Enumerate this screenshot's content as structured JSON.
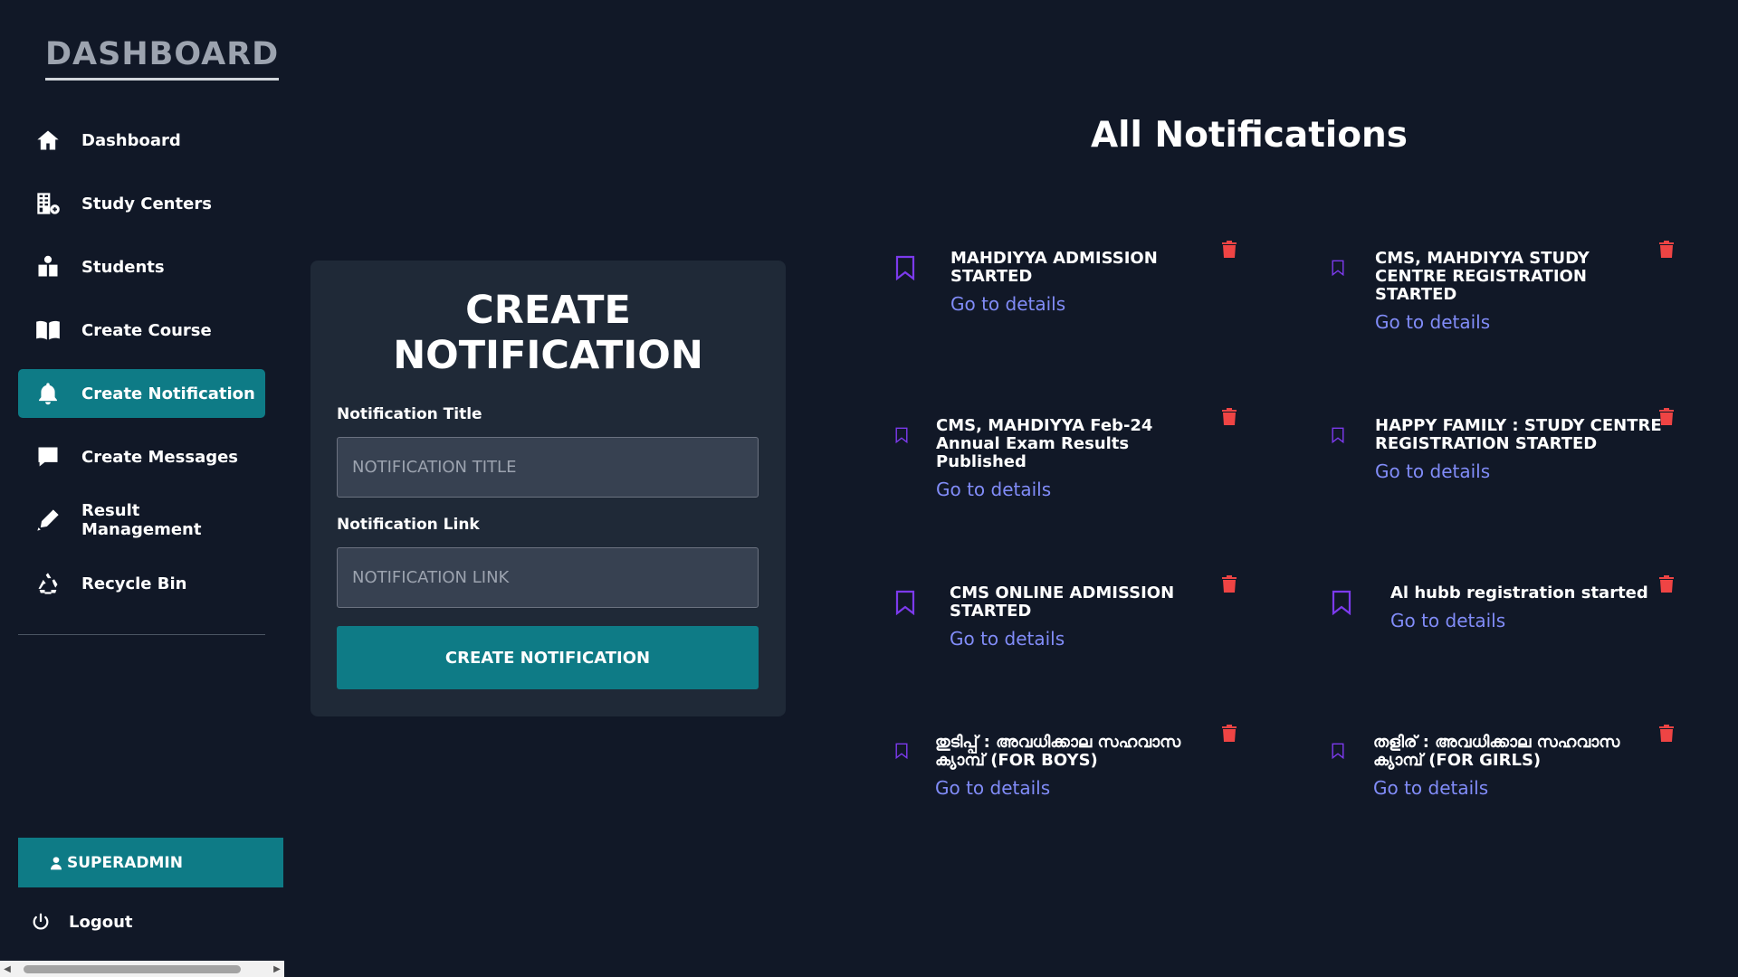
{
  "sidebar": {
    "brand": "DASHBOARD",
    "items": [
      {
        "label": "Dashboard",
        "icon": "home-icon",
        "active": false
      },
      {
        "label": "Study Centers",
        "icon": "building-icon",
        "active": false
      },
      {
        "label": "Students",
        "icon": "students-icon",
        "active": false
      },
      {
        "label": "Create Course",
        "icon": "book-icon",
        "active": false
      },
      {
        "label": "Create Notification",
        "icon": "bell-icon",
        "active": true
      },
      {
        "label": "Create Messages",
        "icon": "message-icon",
        "active": false
      },
      {
        "label": "Result Management",
        "icon": "pen-icon",
        "active": false
      },
      {
        "label": "Recycle Bin",
        "icon": "recycle-icon",
        "active": false
      }
    ],
    "user_label": "SUPERADMIN",
    "logout_label": "Logout"
  },
  "form": {
    "title": "CREATE NOTIFICATION",
    "title_label": "Notification Title",
    "title_placeholder": "NOTIFICATION TITLE",
    "title_value": "",
    "link_label": "Notification Link",
    "link_placeholder": "NOTIFICATION LINK",
    "link_value": "",
    "submit_label": "CREATE NOTIFICATION"
  },
  "notifications": {
    "heading": "All Notifications",
    "link_label": "Go to details",
    "items": [
      {
        "title": "MAHDIYYA ADMISSION STARTED"
      },
      {
        "title": "CMS, MAHDIYYA STUDY CENTRE REGISTRATION STARTED"
      },
      {
        "title": "CMS, MAHDIYYA Feb-24 Annual Exam Results Published"
      },
      {
        "title": "HAPPY FAMILY : STUDY CENTRE REGISTRATION STARTED"
      },
      {
        "title": "CMS ONLINE ADMISSION STARTED"
      },
      {
        "title": "Al hubb registration started"
      },
      {
        "title": "തുടിപ്പ് : അവധിക്കാല സഹവാസ ക്യാമ്പ് (FOR BOYS)"
      },
      {
        "title": "തളിര് : അവധിക്കാല സഹവാസ ക്യാമ്പ് (FOR GIRLS)"
      }
    ]
  },
  "colors": {
    "background": "#111827",
    "card": "#1f2937",
    "accent": "#0e7b86",
    "bookmark": "#7c3aed",
    "delete": "#ef4444",
    "link": "#818cf8"
  }
}
